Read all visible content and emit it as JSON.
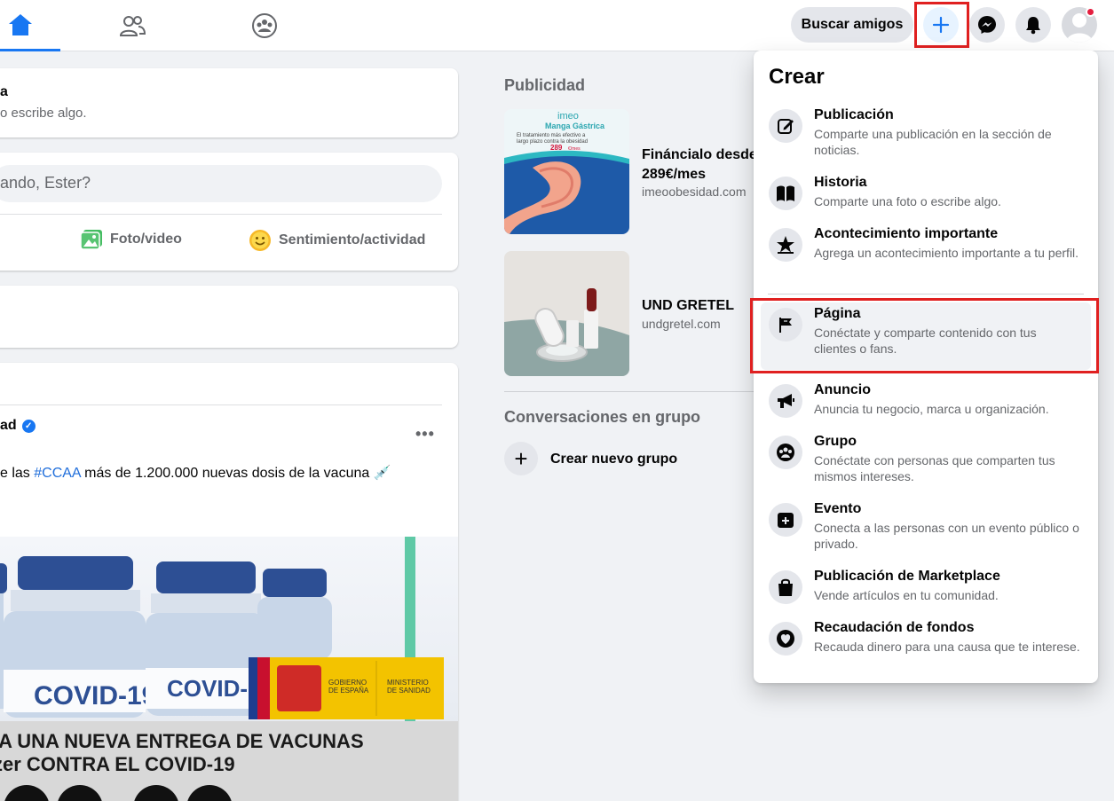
{
  "topbar": {
    "find_friends_label": "Buscar amigos",
    "nav": [
      "home-icon",
      "friends-icon",
      "groups-icon"
    ],
    "buttons": [
      "plus-icon",
      "messenger-icon",
      "bell-icon",
      "avatar"
    ]
  },
  "feed": {
    "story_title": "a",
    "story_sub": "o escribe algo.",
    "composer_placeholder": "ando, Ester?",
    "composer_actions": [
      {
        "label": "Foto/video",
        "icon": "photo-icon"
      },
      {
        "label": "Sentimiento/actividad",
        "icon": "smiley-icon"
      }
    ],
    "post": {
      "author": "ad",
      "text_before": "e las ",
      "hashtag": "#CCAA",
      "text_after": " más de 1.200.000 nuevas dosis de la vacuna",
      "more": "•••",
      "image": {
        "vial_label": "COVID-19",
        "gov_line1": "GOBIERNO",
        "gov_line2": "DE ESPAÑA",
        "min_line1": "MINISTERIO",
        "min_line2": "DE SANIDAD",
        "headline1": "IA UNA NUEVA ENTREGA DE VACUNAS",
        "headline2": "zer CONTRA EL COVID-19"
      }
    }
  },
  "right": {
    "ads_title": "Publicidad",
    "ads": [
      {
        "name_line1": "Fináncialo desde",
        "name_line2": "289€/mes",
        "url": "imeoobesidad.com",
        "thumb": {
          "brand": "imeo",
          "headline": "Manga Gástrica",
          "line1": "El tratamiento más efectivo a",
          "line2": "largo plazo contra la obesidad",
          "price": "289",
          "price_unit": "€/mes"
        }
      },
      {
        "name_line1": "UND GRETEL",
        "url": "undgretel.com"
      }
    ],
    "groups_title": "Conversaciones en grupo",
    "new_group_label": "Crear nuevo grupo"
  },
  "menu": {
    "title": "Crear",
    "items": [
      {
        "title": "Publicación",
        "desc": "Comparte una publicación en la sección de noticias.",
        "icon": "compose-icon"
      },
      {
        "title": "Historia",
        "desc": "Comparte una foto o escribe algo.",
        "icon": "book-icon"
      },
      {
        "title": "Acontecimiento importante",
        "desc": "Agrega un acontecimiento importante a tu perfil.",
        "icon": "star-icon"
      },
      {
        "title": "Página",
        "desc": "Conéctate y comparte contenido con tus clientes o fans.",
        "icon": "flag-icon"
      },
      {
        "title": "Anuncio",
        "desc": "Anuncia tu negocio, marca u organización.",
        "icon": "megaphone-icon"
      },
      {
        "title": "Grupo",
        "desc": "Conéctate con personas que comparten tus mismos intereses.",
        "icon": "group-icon"
      },
      {
        "title": "Evento",
        "desc": "Conecta a las personas con un evento público o privado.",
        "icon": "calendar-plus-icon"
      },
      {
        "title": "Publicación de Marketplace",
        "desc": "Vende artículos en tu comunidad.",
        "icon": "shopping-bag-icon"
      },
      {
        "title": "Recaudación de fondos",
        "desc": "Recauda dinero para una causa que te interese.",
        "icon": "fundraiser-icon"
      }
    ]
  },
  "colors": {
    "accent": "#1877f2",
    "highlight": "#e02020",
    "secondary_text": "#65676b",
    "background": "#f0f2f5"
  }
}
